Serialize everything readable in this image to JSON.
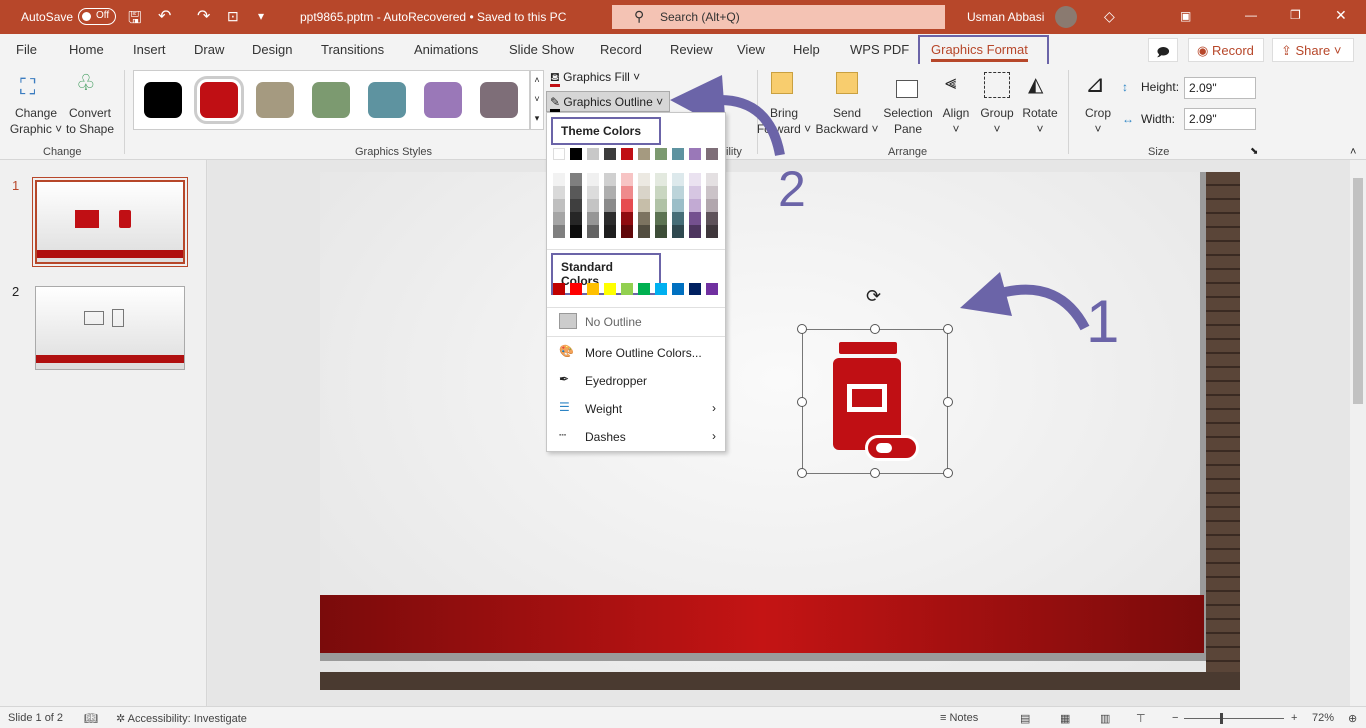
{
  "titlebar": {
    "autosave": "AutoSave",
    "toggle": "Off",
    "filename": "ppt9865.pptm  -  AutoRecovered  •  Saved to this PC",
    "search": "Search (Alt+Q)",
    "user": "Usman Abbasi"
  },
  "tabs": [
    "File",
    "Home",
    "Insert",
    "Draw",
    "Design",
    "Transitions",
    "Animations",
    "Slide Show",
    "Record",
    "Review",
    "View",
    "Help",
    "WPS PDF",
    "Graphics Format"
  ],
  "topright": {
    "record": "Record",
    "share": "Share"
  },
  "ribbon": {
    "change": {
      "change_graphic": "Change\nGraphic ˅",
      "convert": "Convert\nto Shape",
      "group": "Change"
    },
    "styles": {
      "group": "Graphics Styles",
      "swatches": [
        "#000000",
        "#c00f14",
        "#a59a80",
        "#7c9a70",
        "#5e93a0",
        "#9a78b8",
        "#7e6e78"
      ]
    },
    "fill": "Graphics Fill ˅",
    "outline": "Graphics Outline ˅",
    "accessibility_frag": "ility",
    "arrange": {
      "group": "Arrange",
      "bring": "Bring\nForward ˅",
      "send": "Send\nBackward ˅",
      "selection": "Selection\nPane",
      "align": "Align\n˅",
      "group_btn": "Group\n˅",
      "rotate": "Rotate\n˅"
    },
    "size": {
      "group": "Size",
      "crop": "Crop\n˅",
      "height_label": "Height:",
      "height": "2.09\"",
      "width_label": "Width:",
      "width": "2.09\""
    }
  },
  "menu": {
    "theme_header": "Theme Colors",
    "standard_header": "Standard Colors",
    "theme_top": [
      "#ffffff",
      "#000000",
      "#c8c8c8",
      "#3c3c3c",
      "#c00f14",
      "#a59a80",
      "#7c9a70",
      "#5e93a0",
      "#9a78b8",
      "#7e6e78"
    ],
    "theme_tints": [
      [
        "#f2f2f2",
        "#7f7f7f",
        "#f0f0f0",
        "#d0d0d0",
        "#f7c4c4",
        "#ece9e2",
        "#e3e9df",
        "#dde9ec",
        "#eae2f0",
        "#e4e0e2"
      ],
      [
        "#d9d9d9",
        "#595959",
        "#dcdcdc",
        "#aeaeae",
        "#ef8a8c",
        "#d9d4c9",
        "#c9d6c1",
        "#bcd4da",
        "#d6c6e2",
        "#cbc3c8"
      ],
      [
        "#bfbfbf",
        "#3f3f3f",
        "#c4c4c4",
        "#8a8a8a",
        "#e64c50",
        "#c6bea9",
        "#b0c2a6",
        "#9bbec8",
        "#c2aad3",
        "#b1a6ad"
      ],
      [
        "#a5a5a5",
        "#262626",
        "#969696",
        "#2c2c2c",
        "#8f0b0f",
        "#7c7360",
        "#5c7352",
        "#466e78",
        "#74508f",
        "#5e525a"
      ],
      [
        "#7f7f7f",
        "#0c0c0c",
        "#646464",
        "#1e1e1e",
        "#600709",
        "#524d40",
        "#3d4d37",
        "#2f4950",
        "#4d355f",
        "#3f373c"
      ]
    ],
    "standard": [
      "#c00000",
      "#ff0000",
      "#ffc000",
      "#ffff00",
      "#92d050",
      "#00b050",
      "#00b0f0",
      "#0070c0",
      "#002060",
      "#7030a0"
    ],
    "items": [
      {
        "label": "No Outline",
        "icon": "no-outline-icon"
      },
      {
        "label": "More Outline Colors...",
        "icon": "palette-icon"
      },
      {
        "label": "Eyedropper",
        "icon": "eyedropper-icon"
      },
      {
        "label": "Weight",
        "icon": "weight-icon"
      },
      {
        "label": "Dashes",
        "icon": "dashes-icon"
      }
    ]
  },
  "annotations": {
    "one": "1",
    "two": "2",
    "color": "#6b64a8"
  },
  "slides": {
    "numbers": [
      "1",
      "2"
    ]
  },
  "status": {
    "slide": "Slide 1 of 2",
    "accessibility": "Accessibility: Investigate",
    "notes": "Notes",
    "zoom": "72%"
  },
  "colors": {
    "title_bar": "#b7472a",
    "accent": "#c00f14"
  }
}
